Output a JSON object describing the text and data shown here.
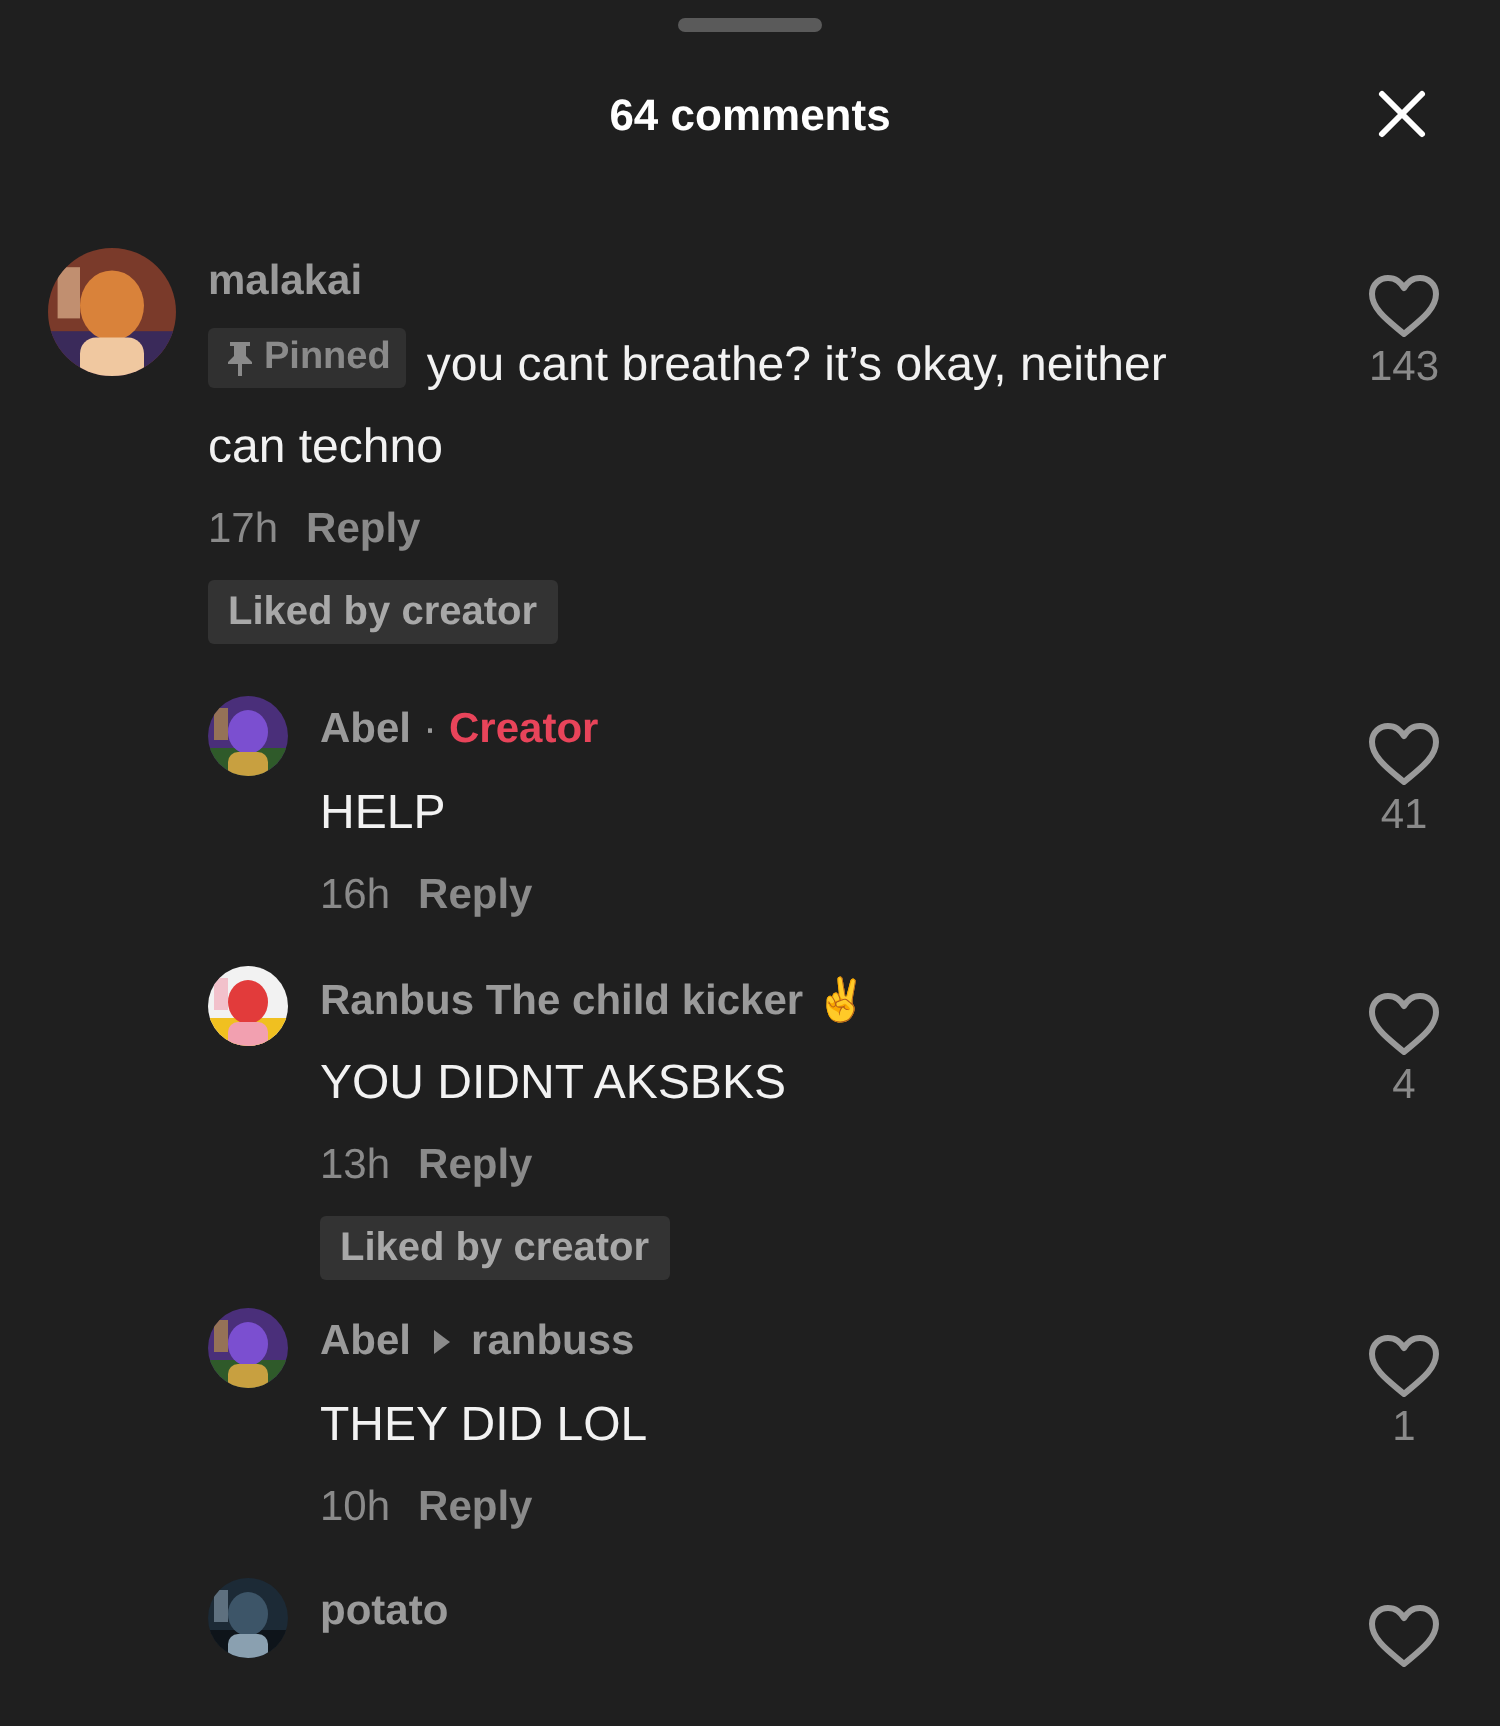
{
  "sheet": {
    "title": "64 comments"
  },
  "comments": [
    {
      "kind": "comment",
      "user": "malakai",
      "pin_label": "Pinned",
      "text": "you cant breathe? it’s okay, neither can techno",
      "time": "17h",
      "reply_label": "Reply",
      "liked_label": "Liked by creator",
      "likes": "143"
    },
    {
      "kind": "reply",
      "user": "Abel",
      "separator": "·",
      "author_tag": "Creator",
      "text": "HELP",
      "time": "16h",
      "reply_label": "Reply",
      "likes": "41"
    },
    {
      "kind": "reply",
      "user": "Ranbus The child kicker ✌️",
      "text": "YOU DIDNT AKSBKS",
      "time": "13h",
      "reply_label": "Reply",
      "liked_label": "Liked by creator",
      "likes": "4"
    },
    {
      "kind": "reply",
      "user": "Abel",
      "reply_to": "ranbuss",
      "text": "THEY DID LOL",
      "time": "10h",
      "reply_label": "Reply",
      "likes": "1"
    },
    {
      "kind": "reply",
      "user": "potato"
    }
  ]
}
